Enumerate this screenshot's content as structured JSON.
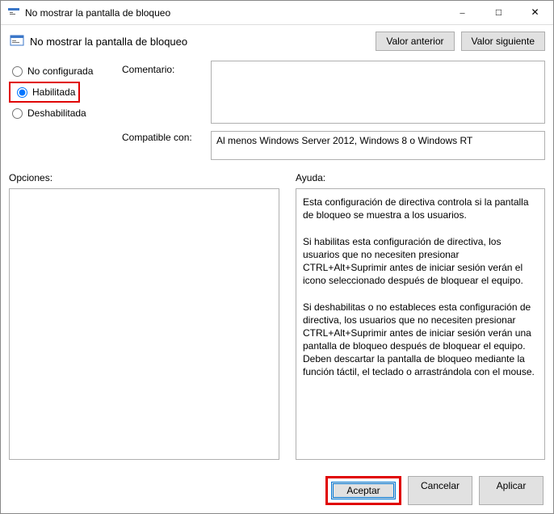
{
  "window": {
    "title": "No mostrar la pantalla de bloqueo"
  },
  "header": {
    "policy_name": "No mostrar la pantalla de bloqueo",
    "prev_button": "Valor anterior",
    "next_button": "Valor siguiente"
  },
  "state": {
    "not_configured": "No configurada",
    "enabled": "Habilitada",
    "disabled": "Deshabilitada",
    "selected": "enabled"
  },
  "fields": {
    "comment_label": "Comentario:",
    "comment_value": "",
    "supported_label": "Compatible con:",
    "supported_value": "Al menos Windows Server 2012, Windows 8 o Windows RT"
  },
  "sections": {
    "options_label": "Opciones:",
    "help_label": "Ayuda:"
  },
  "help_text": "Esta configuración de directiva controla si la pantalla de bloqueo se muestra a los usuarios.\n\nSi habilitas esta configuración de directiva, los usuarios que no necesiten presionar CTRL+Alt+Suprimir antes de iniciar sesión verán el icono seleccionado después de bloquear el equipo.\n\nSi deshabilitas o no estableces esta configuración de directiva, los usuarios que no necesiten presionar CTRL+Alt+Suprimir antes de iniciar sesión verán una pantalla de bloqueo después de bloquear el equipo. Deben descartar la pantalla de bloqueo mediante la función táctil, el teclado o arrastrándola con el mouse.",
  "footer": {
    "ok": "Aceptar",
    "cancel": "Cancelar",
    "apply": "Aplicar"
  }
}
